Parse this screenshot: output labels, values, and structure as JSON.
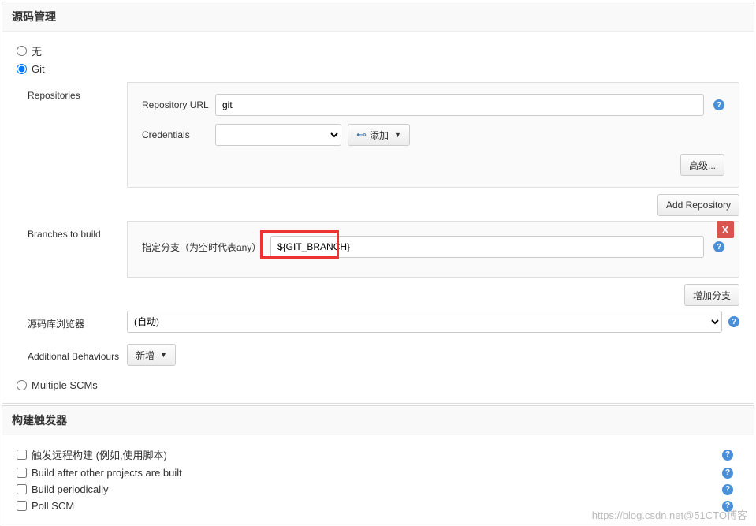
{
  "scm": {
    "header": "源码管理",
    "options": {
      "none": "无",
      "git": "Git",
      "multiple": "Multiple SCMs"
    },
    "repositories": {
      "label": "Repositories",
      "url_label": "Repository URL",
      "url_value": "git",
      "credentials_label": "Credentials",
      "credentials_value": "",
      "add_button": "添加",
      "advanced_button": "高级...",
      "add_repo_button": "Add Repository"
    },
    "branches": {
      "label": "Branches to build",
      "branch_spec_label": "指定分支（为空时代表any）",
      "branch_value": "${GIT_BRANCH}",
      "delete_label": "X",
      "add_branch_button": "增加分支"
    },
    "browser": {
      "label": "源码库浏览器",
      "value": "(自动)"
    },
    "behaviours": {
      "label": "Additional Behaviours",
      "add_button": "新增"
    }
  },
  "triggers": {
    "header": "构建触发器",
    "options": {
      "remote": "触发远程构建 (例如,使用脚本)",
      "after_other": "Build after other projects are built",
      "periodic": "Build periodically",
      "poll": "Poll SCM"
    }
  },
  "help_text": "?",
  "watermark": "https://blog.csdn.net@51CTO博客"
}
